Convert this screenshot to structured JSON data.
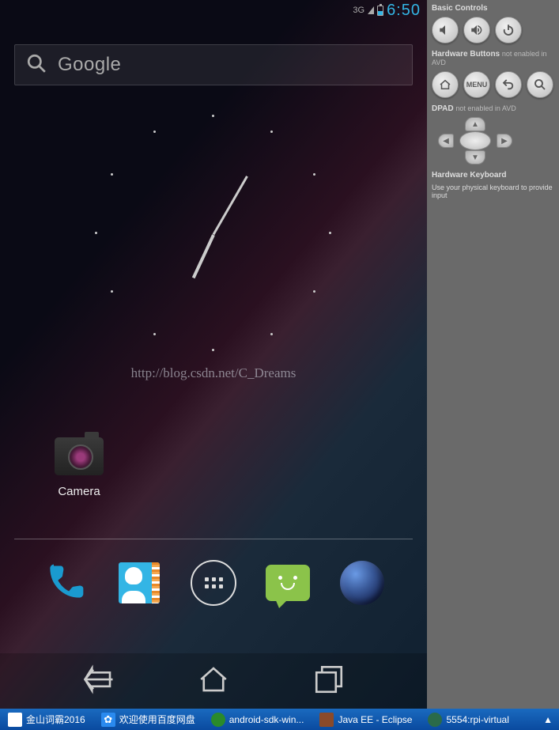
{
  "status": {
    "network": "3G",
    "time": "6:50"
  },
  "search": {
    "placeholder": "Google"
  },
  "watermark": "http://blog.csdn.net/C_Dreams",
  "home_icon": {
    "label": "Camera"
  },
  "controls": {
    "basic_label": "Basic Controls",
    "hw_buttons_label": "Hardware Buttons",
    "hw_buttons_note": "not enabled in AVD",
    "menu_label": "MENU",
    "dpad_label": "DPAD",
    "dpad_note": "not enabled in AVD",
    "kbd_label": "Hardware Keyboard",
    "kbd_note": "Use your physical keyboard to provide input"
  },
  "taskbar": {
    "items": [
      "金山词霸2016",
      "欢迎使用百度网盘",
      "android-sdk-win...",
      "Java EE - Eclipse",
      "5554:rpi-virtual"
    ]
  }
}
